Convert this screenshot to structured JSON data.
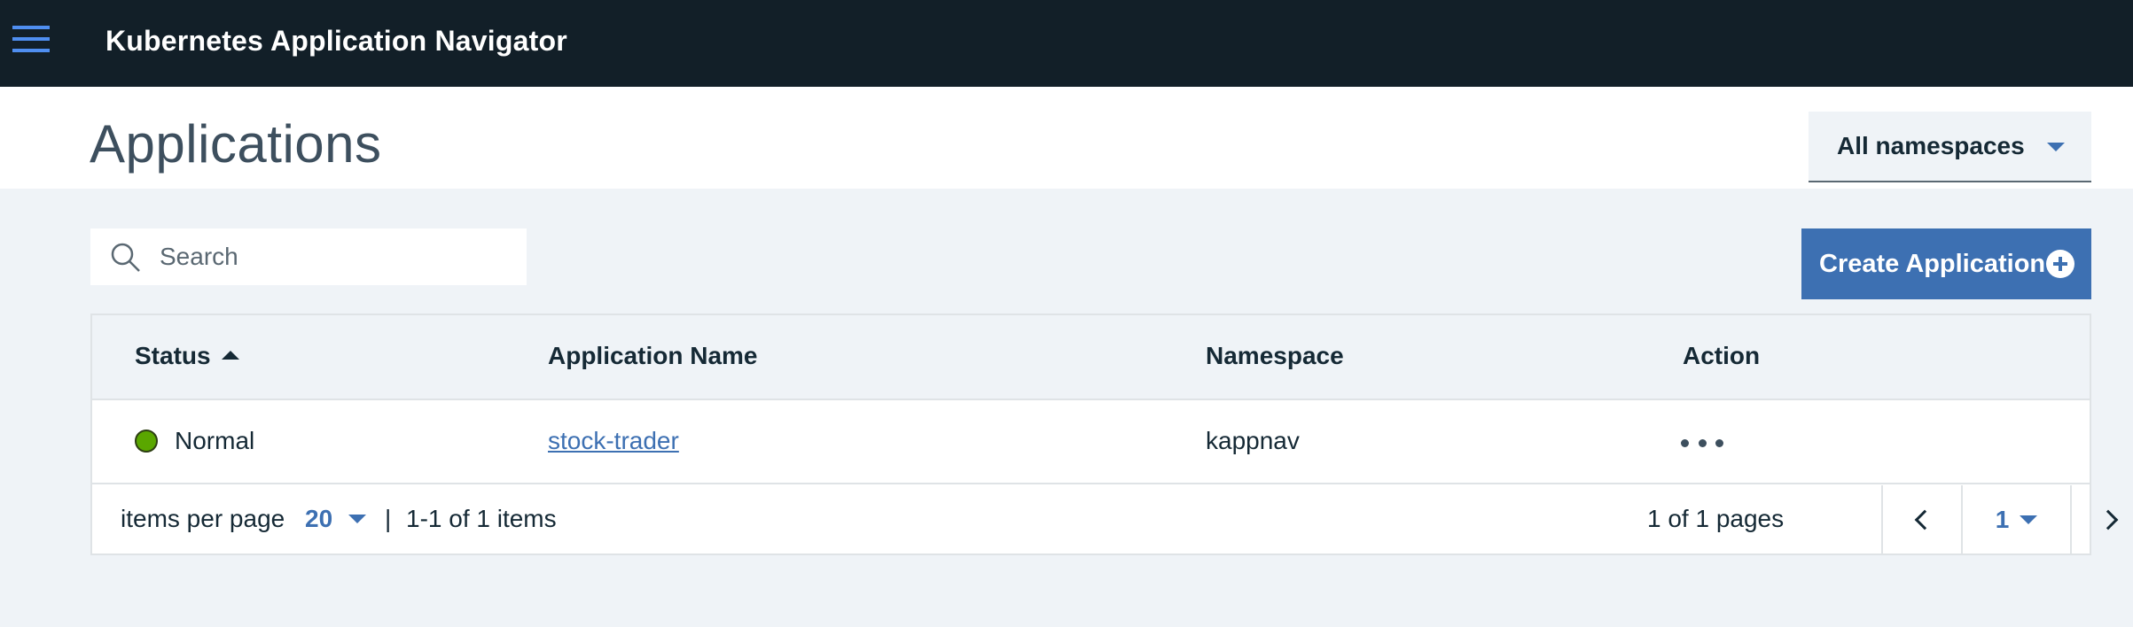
{
  "topbar": {
    "menu_icon": "hamburger-menu-icon",
    "title": "Kubernetes Application Navigator"
  },
  "header": {
    "page_title": "Applications",
    "namespace_dropdown": {
      "selected": "All namespaces",
      "icon": "caret-down-icon"
    }
  },
  "toolbar": {
    "search": {
      "placeholder": "Search",
      "value": "",
      "icon": "search-icon"
    },
    "create_button": {
      "label": "Create Application",
      "icon": "add-circle-icon"
    }
  },
  "table": {
    "columns": [
      {
        "label": "Status",
        "sorted": "ascending"
      },
      {
        "label": "Application Name"
      },
      {
        "label": "Namespace"
      },
      {
        "label": "Action"
      }
    ],
    "rows": [
      {
        "status": "Normal",
        "status_color": "#5aa700",
        "application_name": "stock-trader",
        "namespace": "kappnav",
        "action_icon": "overflow-menu-icon"
      }
    ]
  },
  "pagination": {
    "items_per_page_label": "items per page",
    "items_per_page": "20",
    "separator": "|",
    "range_text": "1-1 of 1 items",
    "pages_text": "1 of 1 pages",
    "current_page": "1"
  },
  "colors": {
    "topbar_bg": "#121f28",
    "accent": "#3d70b2",
    "page_bg": "#eff3f7",
    "status_normal": "#5aa700"
  }
}
